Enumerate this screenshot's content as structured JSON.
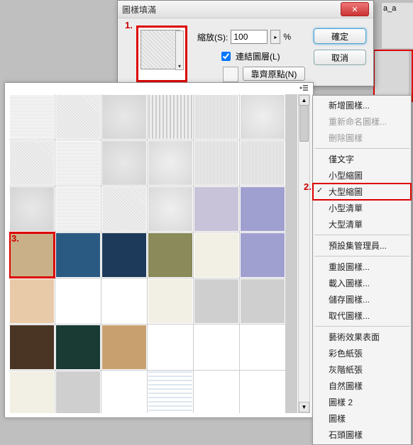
{
  "dialog": {
    "title": "圖樣填滿",
    "scale_label": "縮放(S):",
    "scale_value": "100",
    "scale_unit": "%",
    "link_label": "連結圖層(L)",
    "link_checked": true,
    "snap_label": "靠齊原點(N)",
    "ok_label": "確定",
    "cancel_label": "取消"
  },
  "annotations": {
    "a1": "1.",
    "a2": "2.",
    "a3": "3."
  },
  "options_chars": "a_a",
  "menu": {
    "items": [
      {
        "label": "新增圖樣...",
        "disabled": false
      },
      {
        "label": "重新命名圖樣...",
        "disabled": true
      },
      {
        "label": "刪除圖樣",
        "disabled": true
      },
      {
        "sep": true
      },
      {
        "label": "僅文字",
        "disabled": false
      },
      {
        "label": "小型縮圖",
        "disabled": false
      },
      {
        "label": "大型縮圖",
        "disabled": false,
        "checked": true,
        "highlight": true
      },
      {
        "label": "小型清單",
        "disabled": false
      },
      {
        "label": "大型清單",
        "disabled": false
      },
      {
        "sep": true
      },
      {
        "label": "預設集管理員...",
        "disabled": false
      },
      {
        "sep": true
      },
      {
        "label": "重設圖樣...",
        "disabled": false
      },
      {
        "label": "載入圖樣...",
        "disabled": false
      },
      {
        "label": "儲存圖樣...",
        "disabled": false
      },
      {
        "label": "取代圖樣...",
        "disabled": false
      },
      {
        "sep": true
      },
      {
        "label": "藝術效果表面",
        "disabled": false
      },
      {
        "label": "彩色紙張",
        "disabled": false
      },
      {
        "label": "灰階紙張",
        "disabled": false
      },
      {
        "label": "自然圖樣",
        "disabled": false
      },
      {
        "label": "圖樣 2",
        "disabled": false
      },
      {
        "label": "圖樣",
        "disabled": false
      },
      {
        "label": "石頭圖樣",
        "disabled": false
      }
    ]
  },
  "swatches": {
    "selected_index": 18,
    "rows": 7,
    "cols": 6
  }
}
